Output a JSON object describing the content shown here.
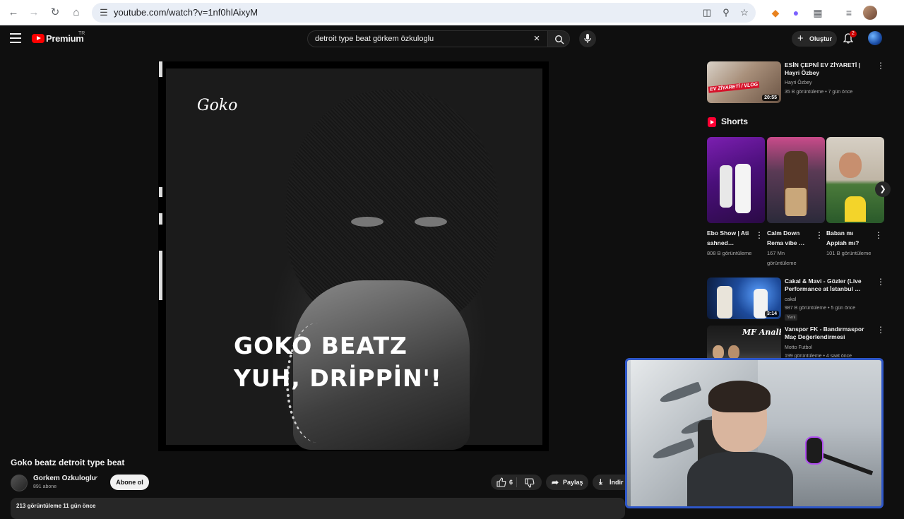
{
  "browser": {
    "url": "youtube.com/watch?v=1nf0hlAixyM"
  },
  "header": {
    "logo_text": "Premium",
    "region": "TR",
    "search_query": "detroit type beat görkem özkuloglu",
    "create_label": "Oluştur",
    "notifications_count": "2"
  },
  "player": {
    "poster_script": "Goko",
    "poster_line1": "GOKO BEATZ",
    "poster_line2": "YUH, DRİPPİN'!"
  },
  "video": {
    "title": "Goko beatz detroit type beat",
    "channel": "Gorkem Ozkuloglu",
    "subscribers": "891 abone",
    "subscribe_label": "Abone ol",
    "likes": "6",
    "share_label": "Paylaş",
    "download_label": "İndir",
    "meta": "213 görüntüleme  11 gün önce"
  },
  "sidebar": {
    "rec_top": {
      "title": "ESİN ÇEPNİ EV ZİYARETİ | Hayri Özbey",
      "channel": "Hayri Özbey",
      "meta": "35 B görüntüleme • 7 gün önce",
      "duration": "20:55",
      "thumb_text": "EV ZİYARETİ / VLOG"
    },
    "shorts_title": "Shorts",
    "shorts": [
      {
        "title": "Ebo Show | Ati sahned…",
        "views": "808 B görüntüleme"
      },
      {
        "title": "Calm Down Rema vibe …",
        "views": "167 Mn görüntüleme"
      },
      {
        "title": "Baban mı Appiah mı?",
        "views": "101 B görüntüleme"
      }
    ],
    "recs": [
      {
        "title": "Cakal & Mavi - Gözler (Live Performance at İstanbul …",
        "channel": "cakal",
        "meta": "987 B görüntüleme • 5 gün önce",
        "badge": "Yeni",
        "duration": "3:14"
      },
      {
        "title": "Vanspor FK - Bandırmaspor Maç Değerlendirmesi",
        "channel": "Motto Futbol",
        "meta": "199 görüntüleme • 4 saat önce",
        "thumb_text": "MF Analiz"
      }
    ]
  },
  "colors": {
    "background": "#0f0f0f",
    "brand_red": "#ff0000",
    "webcam_border": "#2e57c8"
  }
}
